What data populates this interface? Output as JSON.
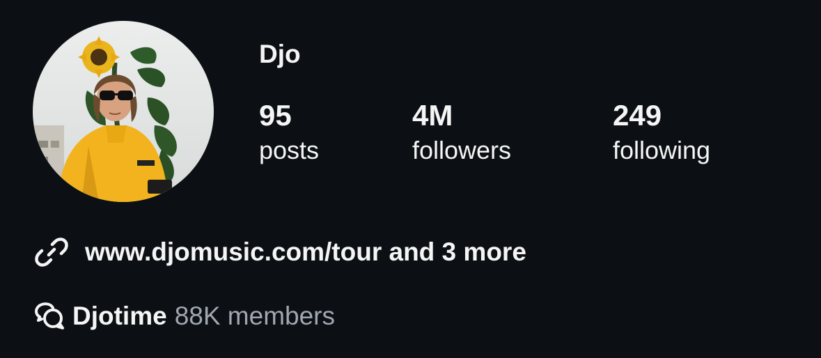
{
  "profile": {
    "username": "Djo",
    "avatar_icon": "profile-photo"
  },
  "stats": {
    "posts": {
      "value": "95",
      "label": "posts"
    },
    "followers": {
      "value": "4M",
      "label": "followers"
    },
    "following": {
      "value": "249",
      "label": "following"
    }
  },
  "links": {
    "icon": "link-icon",
    "text": "www.djomusic.com/tour and 3 more"
  },
  "channel": {
    "icon": "chat-bubbles-icon",
    "name": "Djotime",
    "members": "88K members"
  },
  "colors": {
    "background": "#0c1014",
    "primary_text": "#f5f5f5",
    "secondary_text": "#a0a7b1"
  }
}
